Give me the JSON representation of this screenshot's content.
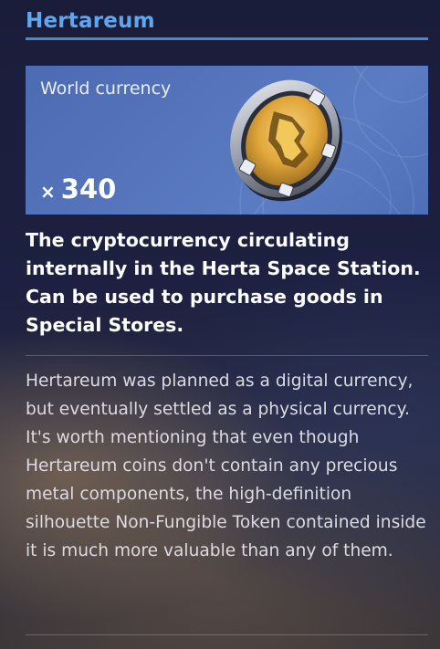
{
  "header": {
    "title": "Hertareum",
    "accent_color": "#5fa6f0"
  },
  "item_card": {
    "label": "World currency",
    "quantity_prefix": "×",
    "quantity": "340",
    "icon": "hertareum-coin-icon",
    "background_color": "#5574bc"
  },
  "description": "The cryptocurrency circulating internally in the Herta Space Station. Can be used to purchase goods in Special Stores.",
  "lore": {
    "paragraphs": [
      "Hertareum was planned as a digital currency, but eventually settled as a physical currency.",
      "It's worth mentioning that even though Hertareum coins don't contain any precious metal components, the high-definition silhouette Non-Fungible Token contained inside it is much more valuable than any of them."
    ]
  }
}
